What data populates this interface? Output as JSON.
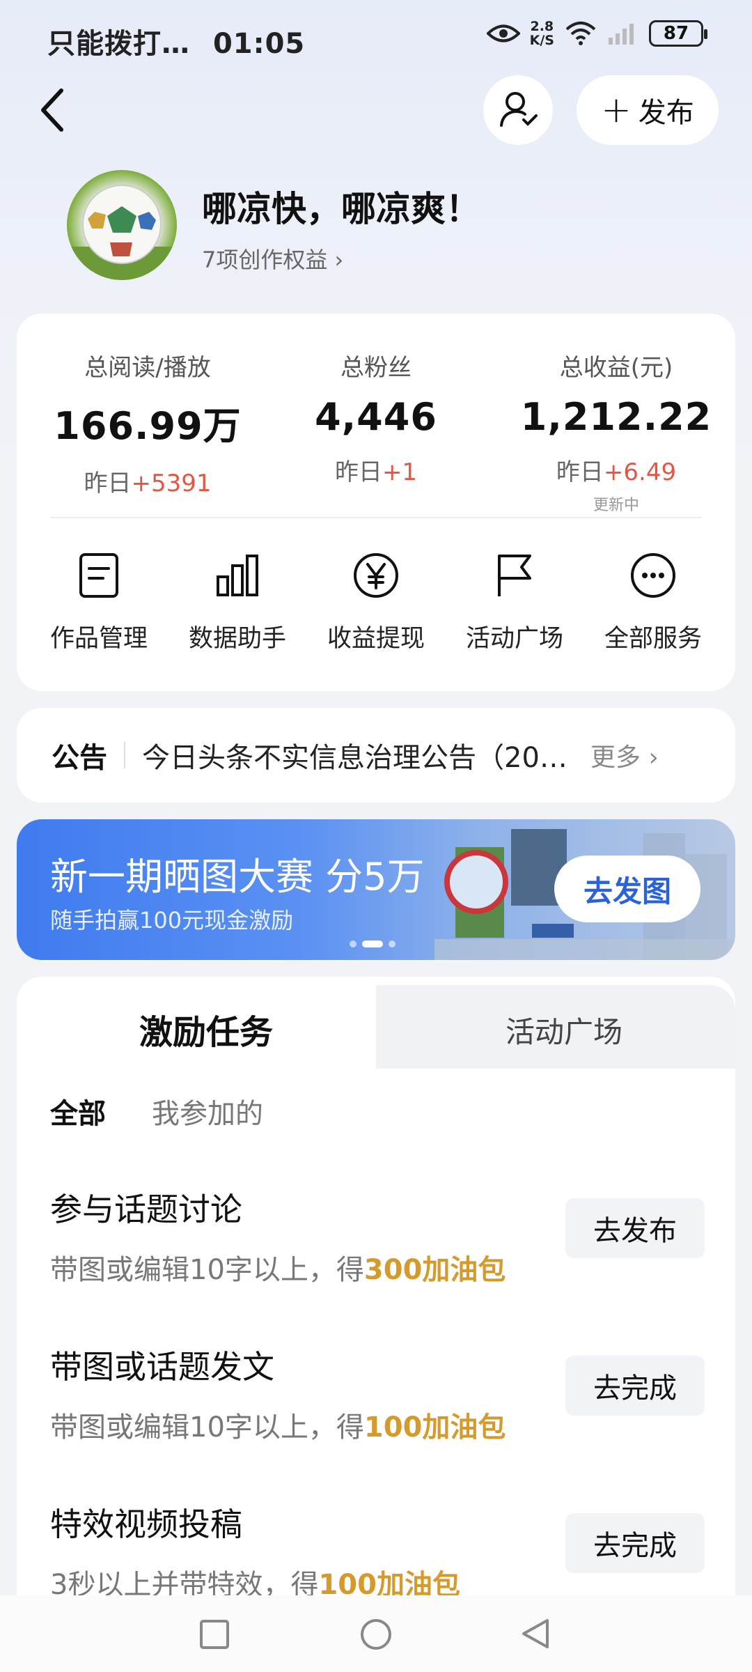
{
  "status_bar": {
    "carrier": "只能拨打…",
    "time": "01:05",
    "net_speed_top": "2.8",
    "net_speed_bottom": "K/S",
    "battery": "87"
  },
  "header": {
    "publish_label": "发布"
  },
  "profile": {
    "name": "哪凉快，哪凉爽！",
    "benefits_label": "7项创作权益"
  },
  "stats": [
    {
      "label": "总阅读/播放",
      "value": "166.99万",
      "change_prefix": "昨日",
      "change": "+5391"
    },
    {
      "label": "总粉丝",
      "value": "4,446",
      "change_prefix": "昨日",
      "change": "+1"
    },
    {
      "label": "总收益(元)",
      "value": "1,212.22",
      "change_prefix": "昨日",
      "change": "+6.49",
      "note": "更新中"
    }
  ],
  "services": [
    {
      "label": "作品管理",
      "icon": "document-icon"
    },
    {
      "label": "数据助手",
      "icon": "bar-chart-icon"
    },
    {
      "label": "收益提现",
      "icon": "yen-icon"
    },
    {
      "label": "活动广场",
      "icon": "flag-icon"
    },
    {
      "label": "全部服务",
      "icon": "more-icon"
    }
  ],
  "notice": {
    "title": "公告",
    "text": "今日头条不实信息治理公告（20…",
    "more": "更多"
  },
  "banner": {
    "title": "新一期晒图大赛 分5万",
    "subtitle": "随手拍赢100元现金激励",
    "button": "去发图"
  },
  "tabs": {
    "active": "激励任务",
    "inactive": "活动广场"
  },
  "filters": {
    "all": "全部",
    "mine": "我参加的"
  },
  "tasks": [
    {
      "title": "参与话题讨论",
      "desc": "带图或编辑10字以上，得",
      "reward": "300加油包",
      "button": "去发布"
    },
    {
      "title": "带图或话题发文",
      "desc": "带图或编辑10字以上，得",
      "reward": "100加油包",
      "button": "去完成"
    },
    {
      "title": "特效视频投稿",
      "desc": "3秒以上并带特效，得",
      "reward": "100加油包",
      "button": "去完成"
    }
  ],
  "colors": {
    "accent_red": "#e25646",
    "reward_gold": "#d69a2b",
    "banner_blue": "#3f7bef"
  }
}
